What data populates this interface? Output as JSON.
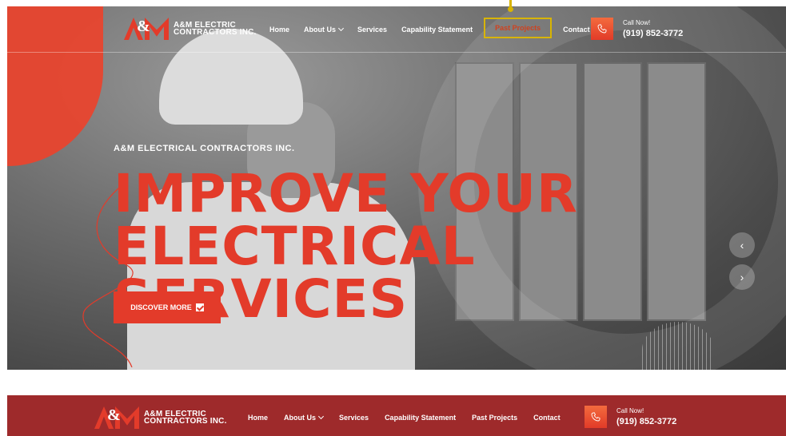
{
  "brand": {
    "logo_line1": "A&M ELECTRIC",
    "logo_line2": "CONTRACTORS INC."
  },
  "nav": {
    "items": [
      {
        "label": "Home"
      },
      {
        "label": "About Us"
      },
      {
        "label": "Services"
      },
      {
        "label": "Capability Statement"
      },
      {
        "label": "Past Projects"
      },
      {
        "label": "Contact"
      }
    ],
    "call_label": "Call Now!",
    "phone": "(919) 852-3772",
    "highlighted_item": "Past Projects"
  },
  "hero": {
    "eyebrow": "A&M ELECTRICAL CONTRACTORS INC.",
    "headline_line1": "IMPROVE YOUR",
    "headline_line2": "ELECTRICAL SERVICES",
    "cta_label": "DISCOVER MORE",
    "prev_glyph": "‹",
    "next_glyph": "›"
  },
  "colors": {
    "accent": "#e33b2a",
    "sticky_bar": "#9e2a2b",
    "highlight": "#d8b400"
  },
  "icons": [
    "phone-icon",
    "chevron-down-icon",
    "check-icon",
    "chevron-left-icon",
    "chevron-right-icon"
  ]
}
